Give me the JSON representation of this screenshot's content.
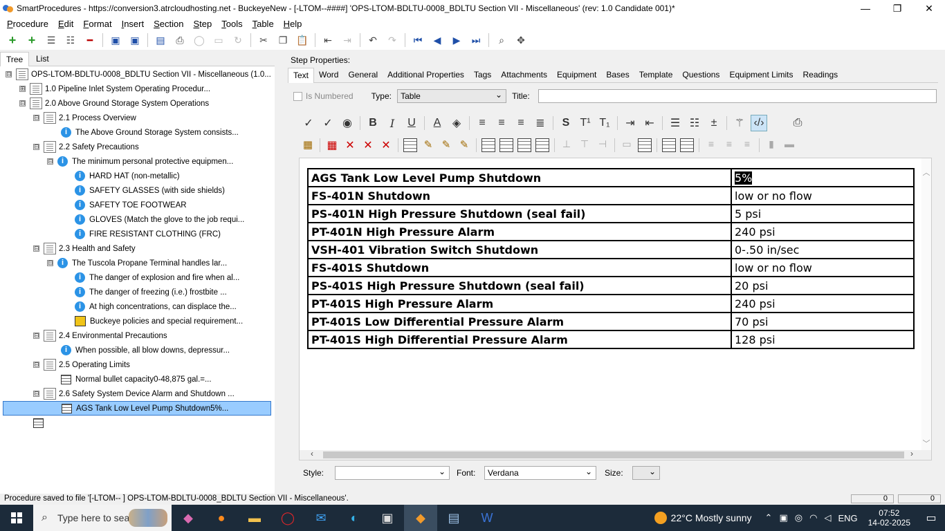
{
  "window": {
    "title": "SmartProcedures - https://conversion3.atrcloudhosting.net - BuckeyeNew - [-LTOM--####] 'OPS-LTOM-BDLTU-0008_BDLTU Section VII - Miscellaneous' (rev: 1.0 Candidate 001)*",
    "minimize": "—",
    "maximize": "❐",
    "close": "✕"
  },
  "menu": [
    "Procedure",
    "Edit",
    "Format",
    "Insert",
    "Section",
    "Step",
    "Tools",
    "Table",
    "Help"
  ],
  "left_tabs": [
    "Tree",
    "List"
  ],
  "tree": [
    {
      "label": "OPS-LTOM-BDLTU-0008_BDLTU Section VII - Miscellaneous (1.0...",
      "exp": "⊟"
    },
    {
      "label": "1.0 Pipeline Inlet System Operating Procedur...",
      "exp": "⊞"
    },
    {
      "label": "2.0 Above Ground Storage System Operations",
      "exp": "⊟"
    },
    {
      "label": "2.1 Process Overview",
      "exp": "⊟"
    },
    {
      "label": "The Above Ground Storage System consists..."
    },
    {
      "label": "2.2 Safety Precautions",
      "exp": "⊟"
    },
    {
      "label": "The minimum personal protective equipmen...",
      "exp": "⊟"
    },
    {
      "label": "HARD HAT (non-metallic)"
    },
    {
      "label": "SAFETY GLASSES (with side shields)"
    },
    {
      "label": "SAFETY TOE FOOTWEAR"
    },
    {
      "label": "GLOVES (Match the glove to the job requi..."
    },
    {
      "label": "FIRE RESISTANT CLOTHING (FRC)"
    },
    {
      "label": "2.3 Health and Safety",
      "exp": "⊟"
    },
    {
      "label": "The Tuscola Propane Terminal handles lar...",
      "exp": "⊟"
    },
    {
      "label": "The danger of explosion and fire when al..."
    },
    {
      "label": "The danger of freezing (i.e.) frostbite ..."
    },
    {
      "label": "At high concentrations, can displace the..."
    },
    {
      "label": "Buckeye policies and special requirement..."
    },
    {
      "label": "2.4 Environmental Precautions",
      "exp": "⊟"
    },
    {
      "label": "When possible, all blow downs, depressur..."
    },
    {
      "label": "2.5 Operating Limits",
      "exp": "⊟"
    },
    {
      "label": "Normal bullet capacity0-48,875 gal.=..."
    },
    {
      "label": "2.6 Safety System Device Alarm and Shutdown ...",
      "exp": "⊟"
    },
    {
      "label": "AGS Tank Low Level Pump Shutdown5%..."
    },
    {
      "label": ""
    }
  ],
  "step_properties": {
    "label": "Step Properties:",
    "tabs": [
      "Text",
      "Word",
      "General",
      "Additional Properties",
      "Tags",
      "Attachments",
      "Equipment",
      "Bases",
      "Template",
      "Questions",
      "Equipment Limits",
      "Readings"
    ],
    "is_numbered_label": "Is Numbered",
    "type_label": "Type:",
    "type_value": "Table",
    "title_label": "Title:",
    "title_value": ""
  },
  "table_rows": [
    [
      "AGS Tank Low Level Pump Shutdown",
      "5%"
    ],
    [
      "FS-401N Shutdown",
      "low or no flow"
    ],
    [
      "PS-401N High Pressure Shutdown (seal fail)",
      "5 psi"
    ],
    [
      "PT-401N High Pressure Alarm",
      "240 psi"
    ],
    [
      "VSH-401 Vibration Switch Shutdown",
      "0-.50 in/sec"
    ],
    [
      "FS-401S Shutdown",
      "low or no flow"
    ],
    [
      "PS-401S High Pressure Shutdown (seal fail)",
      "20 psi"
    ],
    [
      "PT-401S High Pressure Alarm",
      "240 psi"
    ],
    [
      "PT-401S Low Differential Pressure Alarm",
      "70 psi"
    ],
    [
      "PT-401S High Differential Pressure Alarm",
      "128 psi"
    ]
  ],
  "bottom": {
    "style_label": "Style:",
    "style_value": "",
    "font_label": "Font:",
    "font_value": "Verdana",
    "size_label": "Size:",
    "size_value": ""
  },
  "status": {
    "text": "Procedure saved to file '[-LTOM--    ] OPS-LTOM-BDLTU-0008_BDLTU Section VII - Miscellaneous'.",
    "box1": "0",
    "box2": "0"
  },
  "taskbar": {
    "search_placeholder": "Type here to search",
    "weather": "22°C  Mostly sunny",
    "lang": "ENG",
    "time": "07:52",
    "date": "14-02-2025"
  }
}
